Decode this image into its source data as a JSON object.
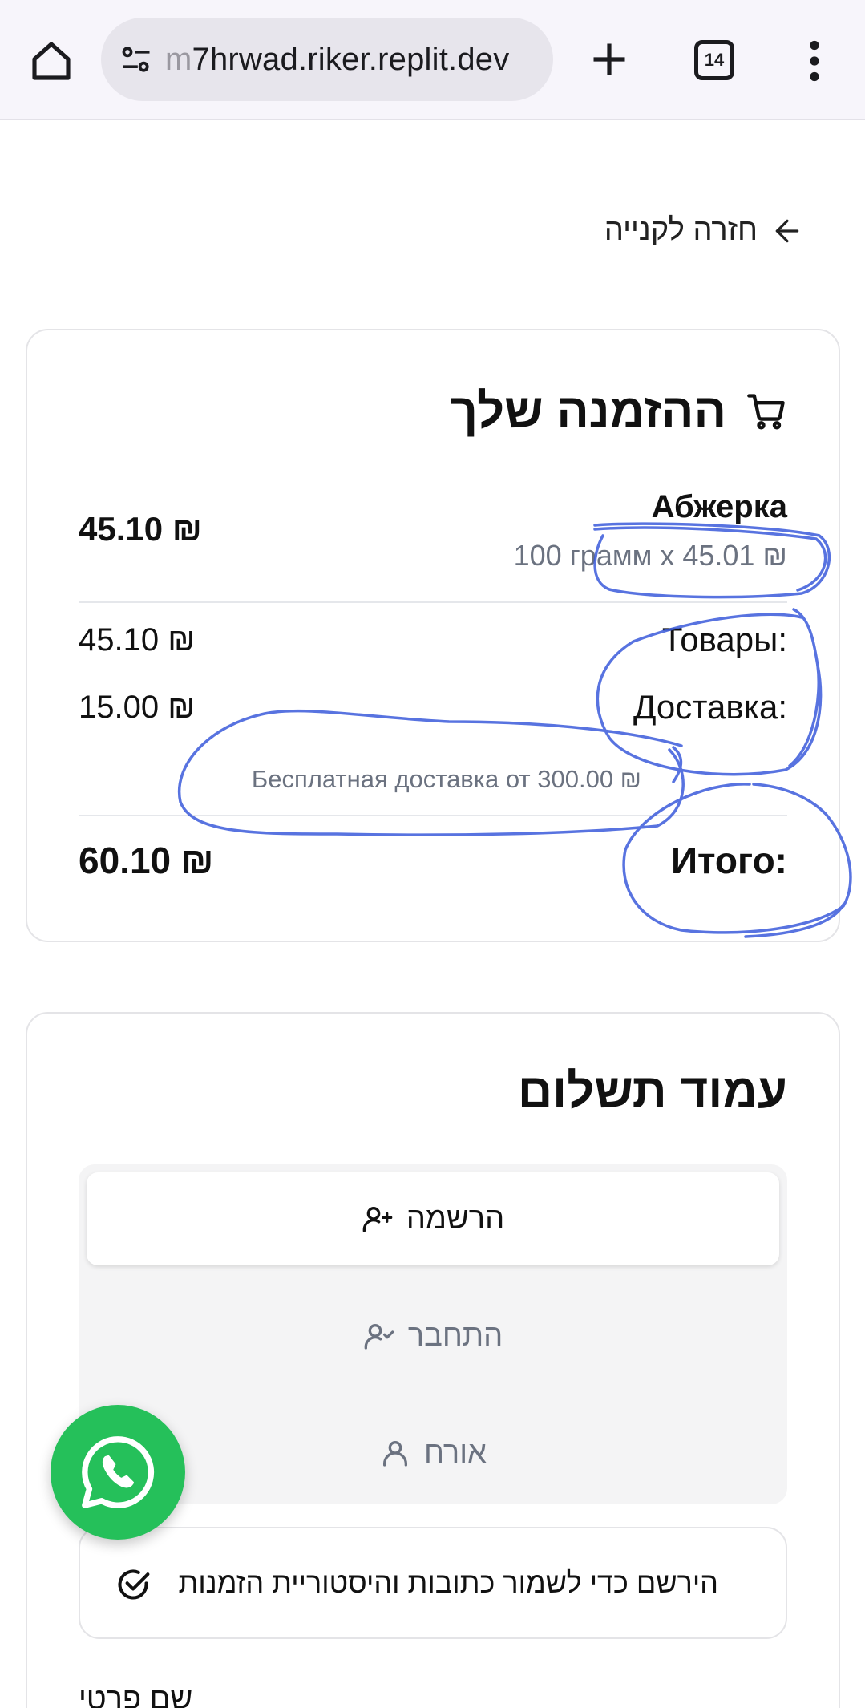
{
  "browser": {
    "url_faded": "m",
    "url": "7hrwad.riker.replit.dev",
    "tab_count": "14"
  },
  "back_link": {
    "label": "חזרה לקנייה"
  },
  "order": {
    "title": "ההזמנה שלך",
    "item": {
      "name": "Абжерка",
      "detail": "100 грамм x 45.01 ₪",
      "price": "45.10 ₪"
    },
    "goods_label": "Товары:",
    "goods_value": "45.10 ₪",
    "delivery_label": "Доставка:",
    "delivery_value": "15.00 ₪",
    "free_delivery_note": "Бесплатная доставка от 300.00 ₪",
    "total_label": "Итого:",
    "total_value": "60.10 ₪"
  },
  "payment": {
    "title": "עמוד תשלום",
    "tabs": [
      {
        "label": "הרשמה",
        "icon": "user-plus-icon",
        "active": true
      },
      {
        "label": "התחבר",
        "icon": "user-check-icon",
        "active": false
      },
      {
        "label": "אורח",
        "icon": "user-icon",
        "active": false
      }
    ],
    "info_text": "הירשם כדי לשמור כתובות והיסטוריית הזמנות",
    "first_name_label": "שם פרטי"
  },
  "colors": {
    "accent_green": "#25c05a",
    "scribble_blue": "#3b5bdb",
    "muted_text": "#6b7280"
  }
}
